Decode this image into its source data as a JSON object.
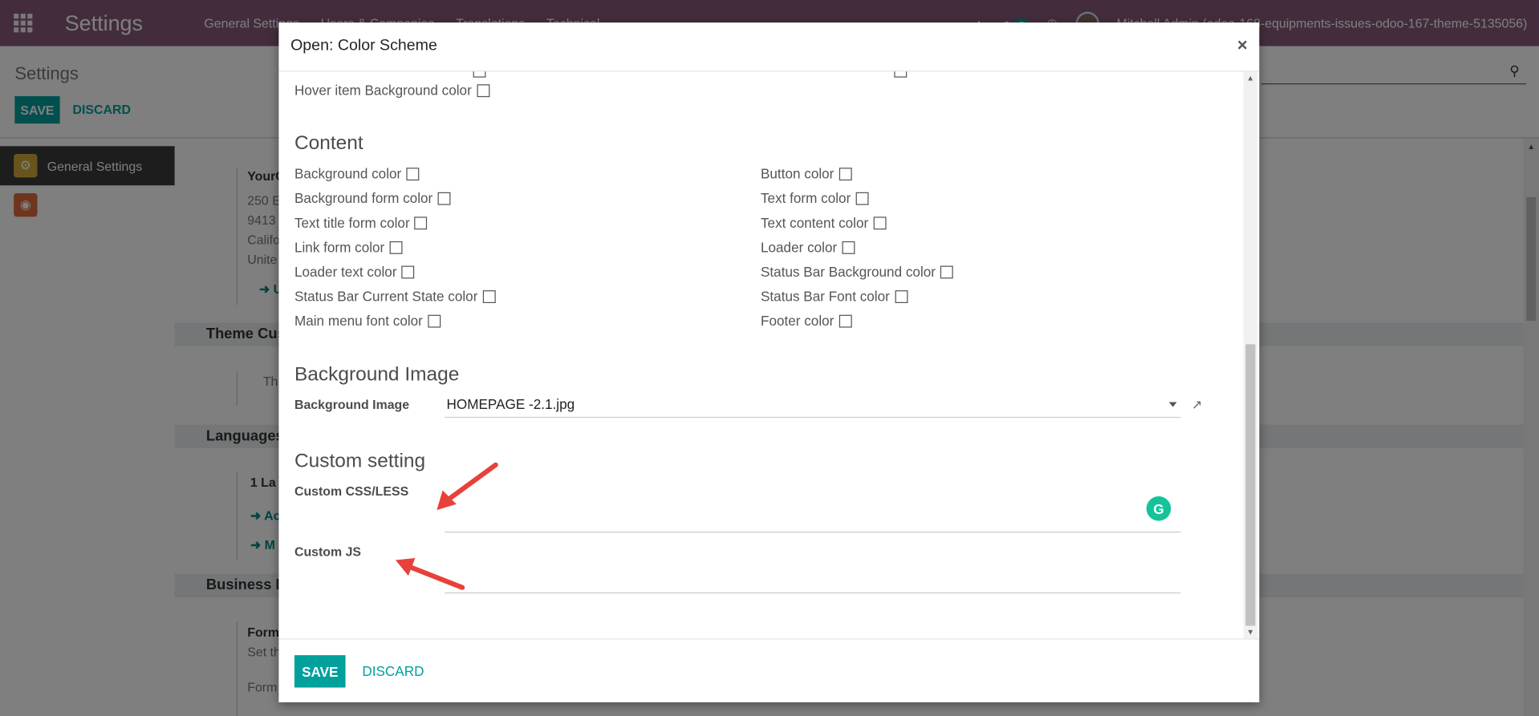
{
  "navbar": {
    "brand": "Settings",
    "menu": [
      "General Settings",
      "Users & Companies",
      "Translations",
      "Technical"
    ],
    "badge": "5",
    "user": "Mitchell Admin (odoo-168-equipments-issues-odoo-167-theme-5135056)"
  },
  "control": {
    "title": "Settings",
    "save": "SAVE",
    "discard": "DISCARD"
  },
  "sidebar": {
    "items": [
      {
        "label": "General Settings"
      },
      {
        "label": ""
      }
    ]
  },
  "background": {
    "company_name": "YourC",
    "addr1": "250 E",
    "addr2": "9413",
    "addr3": "Califo",
    "addr4": "Unite",
    "link_u": "U",
    "theme_header": "Theme Cus",
    "theme_text": "Th",
    "languages_header": "Languages",
    "lang_count": "1 La",
    "lang_link1": "Ac",
    "lang_link2": "M",
    "business_header": "Business D",
    "format_title": "Form",
    "format_sub": "Set th",
    "format_label": "Form"
  },
  "modal": {
    "title": "Open: Color Scheme",
    "close": "×",
    "hover_bg": "Hover item Background color",
    "content_title": "Content",
    "left_fields": [
      "Background color",
      "Background form color",
      "Text title form color",
      "Link form color",
      "Loader text color",
      "Status Bar Current State color",
      "Main menu font color"
    ],
    "right_fields": [
      "Button color",
      "Text form color",
      "Text content color",
      "Loader color",
      "Status Bar Background color",
      "Status Bar Font color",
      "Footer color"
    ],
    "bg_image_title": "Background Image",
    "bg_image_label": "Background Image",
    "bg_image_value": "HOMEPAGE -2.1.jpg",
    "custom_title": "Custom setting",
    "custom_css_label": "Custom CSS/LESS",
    "custom_js_label": "Custom JS",
    "grammarly": "G",
    "save": "SAVE",
    "discard": "DISCARD"
  },
  "colors": {
    "navbar": "#875a7b",
    "accent": "#00a09d",
    "arrow": "#e8403a"
  }
}
